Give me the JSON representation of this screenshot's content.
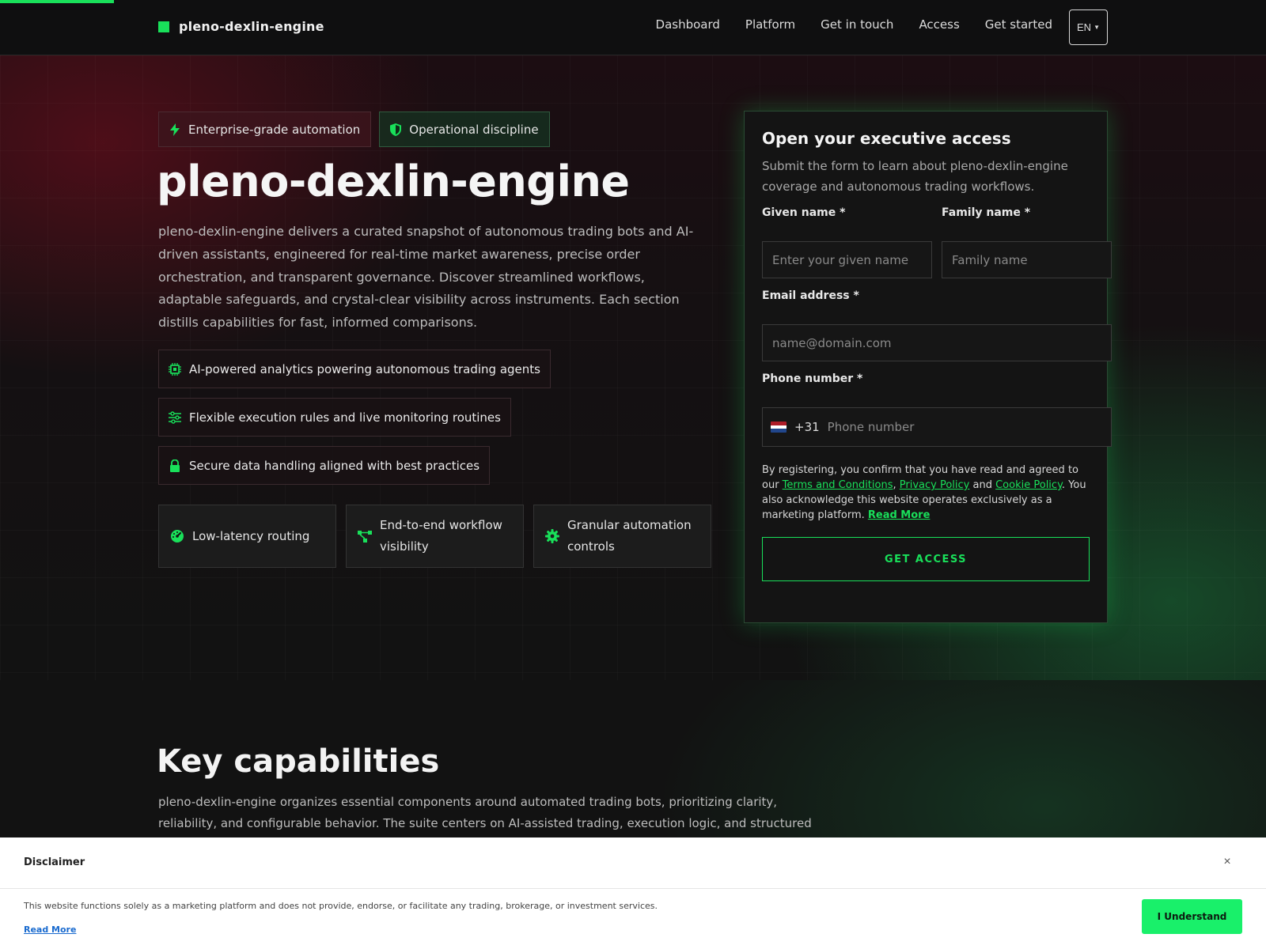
{
  "colors": {
    "accent": "#19e05a",
    "flag_red": "#ae1c28",
    "flag_white": "#ffffff",
    "flag_blue": "#21468b"
  },
  "header": {
    "brand": "pleno-dexlin-engine",
    "nav": [
      "Dashboard",
      "Platform",
      "Get in touch",
      "Access",
      "Get started"
    ],
    "language": "EN"
  },
  "hero": {
    "pills": [
      {
        "icon": "bolt-icon",
        "label": "Enterprise-grade automation"
      },
      {
        "icon": "shield-icon",
        "label": "Operational discipline"
      }
    ],
    "title": "pleno-dexlin-engine",
    "description": "pleno-dexlin-engine delivers a curated snapshot of autonomous trading bots and AI-driven assistants, engineered for real-time market awareness, precise order orchestration, and transparent governance. Discover streamlined workflows, adaptable safeguards, and crystal-clear visibility across instruments. Each section distills capabilities for fast, informed comparisons.",
    "features": [
      {
        "icon": "chip-icon",
        "label": "AI-powered analytics powering autonomous trading agents"
      },
      {
        "icon": "sliders-icon",
        "label": "Flexible execution rules and live monitoring routines"
      },
      {
        "icon": "lock-icon",
        "label": "Secure data handling aligned with best practices"
      }
    ],
    "cards": [
      {
        "icon": "speedometer-icon",
        "label": "Low-latency routing"
      },
      {
        "icon": "workflow-icon",
        "label": "End-to-end workflow visibility"
      },
      {
        "icon": "gear-icon",
        "label": "Granular automation controls"
      }
    ]
  },
  "form": {
    "title": "Open your executive access",
    "subtitle": "Submit the form to learn about pleno-dexlin-engine coverage and autonomous trading workflows.",
    "given_label": "Given name *",
    "given_placeholder": "Enter your given name",
    "family_label": "Family name *",
    "family_placeholder": "Family name",
    "email_label": "Email address *",
    "email_placeholder": "name@domain.com",
    "phone_label": "Phone number *",
    "phone_code": "+31",
    "phone_placeholder": "Phone number",
    "consent": {
      "prefix": "By registering, you confirm that you have read and agreed to our ",
      "terms": "Terms and Conditions",
      "sep1": ", ",
      "privacy": "Privacy Policy",
      "sep2": " and ",
      "cookie": "Cookie Policy",
      "suffix": ". You also acknowledge this website operates exclusively as a marketing platform. ",
      "read_more": "Read More"
    },
    "submit": "GET ACCESS"
  },
  "capabilities": {
    "title": "Key capabilities",
    "description": "pleno-dexlin-engine organizes essential components around automated trading bots, prioritizing clarity, reliability, and configurable behavior. The suite centers on AI-assisted trading, execution logic, and structured monitoring to support"
  },
  "disclaimer": {
    "title": "Disclaimer",
    "close": "×",
    "text": "This website functions solely as a marketing platform and does not provide, endorse, or facilitate any trading, brokerage, or investment services.",
    "read_more": "Read More",
    "button": "I Understand"
  }
}
